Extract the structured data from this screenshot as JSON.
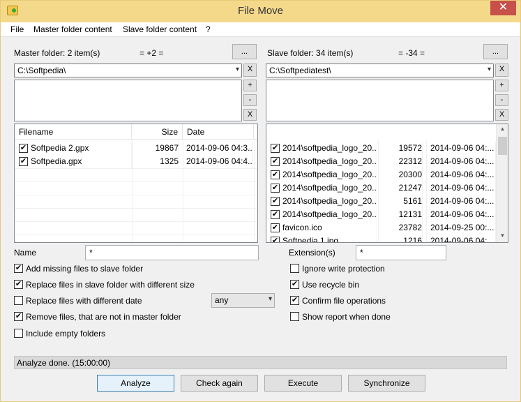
{
  "window": {
    "title": "File Move",
    "close_label": "✕"
  },
  "menu": {
    "items": [
      "File",
      "Master folder content",
      "Slave folder content",
      "?"
    ]
  },
  "master": {
    "label": "Master folder: 2 item(s)",
    "diff": "= +2 =",
    "browse_label": "...",
    "path": "C:\\Softpedia\\",
    "remove_label": "X",
    "extra_buttons": [
      "+",
      "-",
      "X"
    ],
    "columns": [
      "Filename",
      "Size",
      "Date"
    ],
    "rows": [
      {
        "name": "Softpedia 2.gpx",
        "size": "19867",
        "date": "2014-09-06 04:3..."
      },
      {
        "name": "Softpedia.gpx",
        "size": "1325",
        "date": "2014-09-06 04:4..."
      }
    ]
  },
  "slave": {
    "label": "Slave folder: 34 item(s)",
    "diff": "= -34 =",
    "browse_label": "...",
    "path": "C:\\Softpediatest\\",
    "remove_label": "X",
    "extra_buttons": [
      "+",
      "-",
      "X"
    ],
    "rows": [
      {
        "name": "2014\\softpedia_logo_20...",
        "size": "19572",
        "date": "2014-09-06 04:..."
      },
      {
        "name": "2014\\softpedia_logo_20...",
        "size": "22312",
        "date": "2014-09-06 04:..."
      },
      {
        "name": "2014\\softpedia_logo_20...",
        "size": "20300",
        "date": "2014-09-06 04:..."
      },
      {
        "name": "2014\\softpedia_logo_20...",
        "size": "21247",
        "date": "2014-09-06 04:..."
      },
      {
        "name": "2014\\softpedia_logo_20...",
        "size": "5161",
        "date": "2014-09-06 04:..."
      },
      {
        "name": "2014\\softpedia_logo_20...",
        "size": "12131",
        "date": "2014-09-06 04:..."
      },
      {
        "name": "favicon.ico",
        "size": "23782",
        "date": "2014-09-25 00:..."
      },
      {
        "name": "Softpedia 1.jpg",
        "size": "1216",
        "date": "2014-09-06 04:..."
      }
    ]
  },
  "filters": {
    "name_label": "Name",
    "name_value": "*",
    "ext_label": "Extension(s)",
    "ext_value": "*"
  },
  "options_left": [
    {
      "label": "Add missing files to slave folder",
      "checked": true
    },
    {
      "label": "Replace files in slave folder with different size",
      "checked": true
    },
    {
      "label": "Replace files with different date",
      "checked": false
    },
    {
      "label": "Remove files, that are not in master folder",
      "checked": true
    },
    {
      "label": "Include empty folders",
      "checked": false
    }
  ],
  "date_mode": {
    "selected": "any"
  },
  "options_right": [
    {
      "label": "Ignore write protection",
      "checked": false
    },
    {
      "label": "Use recycle bin",
      "checked": true
    },
    {
      "label": "Confirm file operations",
      "checked": true
    },
    {
      "label": "Show report when done",
      "checked": false
    }
  ],
  "status": {
    "text": "Analyze done. (15:00:00)"
  },
  "actions": {
    "analyze": "Analyze",
    "check_again": "Check again",
    "execute": "Execute",
    "synchronize": "Synchronize"
  },
  "icons": {
    "app": "folder-move-icon",
    "check": "✔",
    "dropdown": "▾"
  }
}
